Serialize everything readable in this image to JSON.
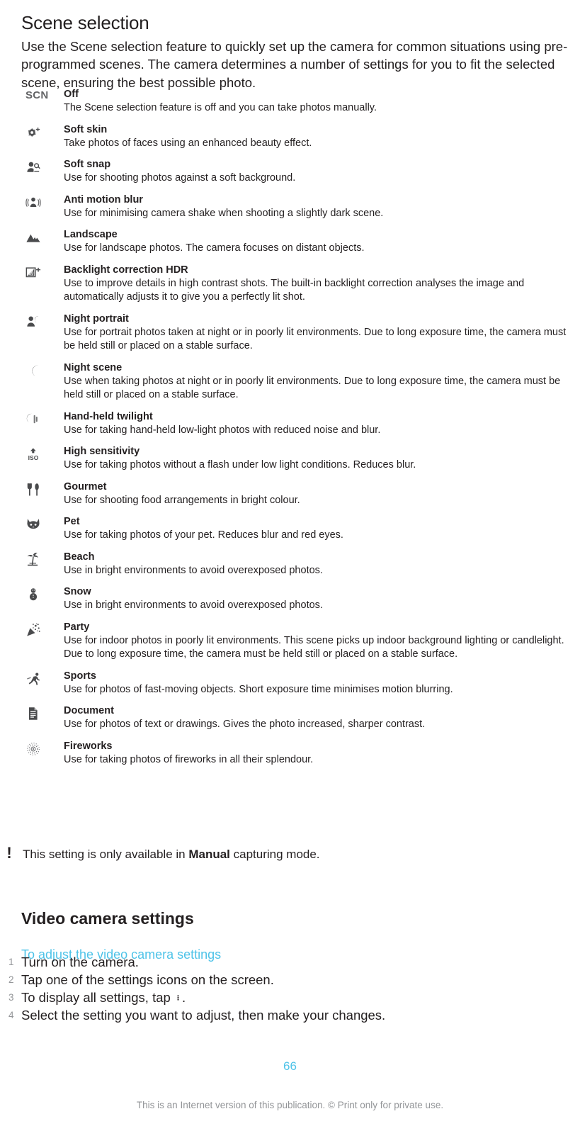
{
  "colors": {
    "accent_blue": "#4ec3e8",
    "body_text": "#231f20",
    "muted_grey": "#939598",
    "icon_grey": "#6d6e71"
  },
  "heading": "Scene selection",
  "intro": "Use the Scene selection feature to quickly set up the camera for common situations using pre-programmed scenes. The camera determines a number of settings for you to fit the selected scene, ensuring the best possible photo.",
  "scenes": [
    {
      "icon": "scn-text-icon",
      "title": "Off",
      "description": "The Scene selection feature is off and you can take photos manually."
    },
    {
      "icon": "soft-skin-icon",
      "title": "Soft skin",
      "description": "Take photos of faces using an enhanced beauty effect."
    },
    {
      "icon": "soft-snap-icon",
      "title": "Soft snap",
      "description": "Use for shooting photos against a soft background."
    },
    {
      "icon": "anti-motion-blur-icon",
      "title": "Anti motion blur",
      "description": "Use for minimising camera shake when shooting a slightly dark scene."
    },
    {
      "icon": "landscape-icon",
      "title": "Landscape",
      "description": "Use for landscape photos. The camera focuses on distant objects."
    },
    {
      "icon": "backlight-hdr-icon",
      "title": "Backlight correction HDR",
      "description": "Use to improve details in high contrast shots. The built-in backlight correction analyses the image and automatically adjusts it to give you a perfectly lit shot."
    },
    {
      "icon": "night-portrait-icon",
      "title": "Night portrait",
      "description": "Use for portrait photos taken at night or in poorly lit environments. Due to long exposure time, the camera must be held still or placed on a stable surface."
    },
    {
      "icon": "night-scene-icon",
      "title": "Night scene",
      "description": "Use when taking photos at night or in poorly lit environments. Due to long exposure time, the camera must be held still or placed on a stable surface."
    },
    {
      "icon": "hand-held-twilight-icon",
      "title": "Hand-held twilight",
      "description": "Use for taking hand-held low-light photos with reduced noise and blur."
    },
    {
      "icon": "high-sensitivity-iso-icon",
      "title": "High sensitivity",
      "description": "Use for taking photos without a flash under low light conditions. Reduces blur."
    },
    {
      "icon": "gourmet-icon",
      "title": "Gourmet",
      "description": "Use for shooting food arrangements in bright colour."
    },
    {
      "icon": "pet-icon",
      "title": "Pet",
      "description": "Use for taking photos of your pet. Reduces blur and red eyes."
    },
    {
      "icon": "beach-icon",
      "title": "Beach",
      "description": "Use in bright environments to avoid overexposed photos."
    },
    {
      "icon": "snow-icon",
      "title": "Snow",
      "description": "Use in bright environments to avoid overexposed photos."
    },
    {
      "icon": "party-icon",
      "title": "Party",
      "description": "Use for indoor photos in poorly lit environments. This scene picks up indoor background lighting or candlelight. Due to long exposure time, the camera must be held still or placed on a stable surface."
    },
    {
      "icon": "sports-icon",
      "title": "Sports",
      "description": "Use for photos of fast-moving objects. Short exposure time minimises motion blurring."
    },
    {
      "icon": "document-icon",
      "title": "Document",
      "description": "Use for photos of text or drawings. Gives the photo increased, sharper contrast."
    },
    {
      "icon": "fireworks-icon",
      "title": "Fireworks",
      "description": "Use for taking photos of fireworks in all their splendour."
    }
  ],
  "note": {
    "icon": "exclamation-icon",
    "icon_glyph": "!",
    "text_before": "This setting is only available in ",
    "bold_term": "Manual",
    "text_after": " capturing mode."
  },
  "section2": {
    "heading": "Video camera settings",
    "subheading": "To adjust the video camera settings",
    "steps": [
      {
        "num": "1",
        "text": "Turn on the camera."
      },
      {
        "num": "2",
        "text": "Tap one of the settings icons on the screen."
      },
      {
        "num": "3",
        "text_before": "To display all settings, tap ",
        "icon": "overflow-menu-icon",
        "text_after": "."
      },
      {
        "num": "4",
        "text": "Select the setting you want to adjust, then make your changes."
      }
    ]
  },
  "footer": {
    "page_number": "66",
    "disclaimer": "This is an Internet version of this publication. © Print only for private use."
  },
  "scn_label": "SCN"
}
